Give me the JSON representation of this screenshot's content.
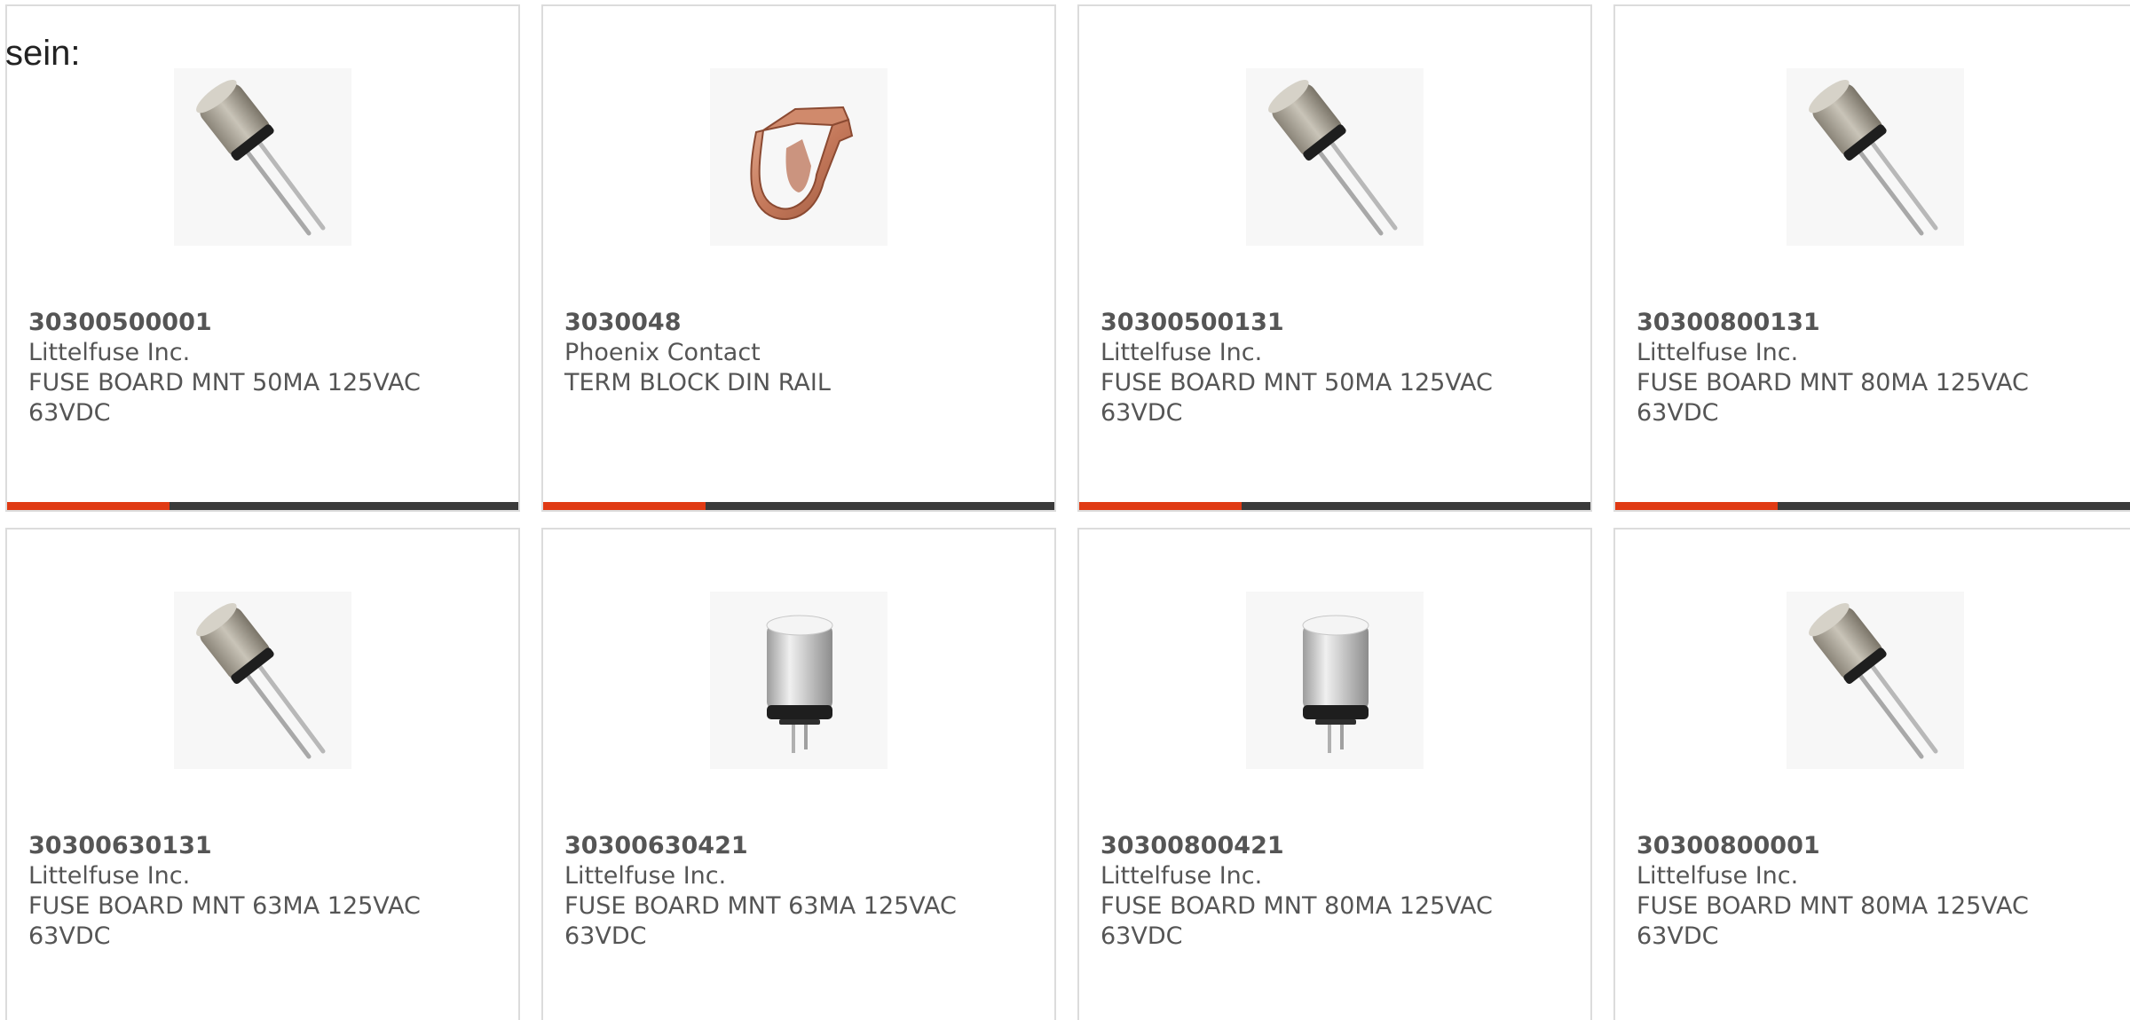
{
  "lead_text": "sein:",
  "colors": {
    "accent": "#e03a14",
    "bar": "#3a3a3a",
    "border": "#dcdcdc",
    "text": "#555555"
  },
  "products": [
    {
      "part_number": "30300500001",
      "manufacturer": "Littelfuse Inc.",
      "description": "FUSE BOARD MNT 50MA 125VAC 63VDC",
      "image": "radial-fuse-angled-icon"
    },
    {
      "part_number": "3030048",
      "manufacturer": "Phoenix Contact",
      "description": "TERM BLOCK DIN RAIL",
      "image": "copper-clip-icon"
    },
    {
      "part_number": "30300500131",
      "manufacturer": "Littelfuse Inc.",
      "description": "FUSE BOARD MNT 50MA 125VAC 63VDC",
      "image": "radial-fuse-angled-icon"
    },
    {
      "part_number": "30300800131",
      "manufacturer": "Littelfuse Inc.",
      "description": "FUSE BOARD MNT 80MA 125VAC 63VDC",
      "image": "radial-fuse-angled-icon"
    },
    {
      "part_number": "30300630131",
      "manufacturer": "Littelfuse Inc.",
      "description": "FUSE BOARD MNT 63MA 125VAC 63VDC",
      "image": "radial-fuse-angled-icon"
    },
    {
      "part_number": "30300630421",
      "manufacturer": "Littelfuse Inc.",
      "description": "FUSE BOARD MNT 63MA 125VAC 63VDC",
      "image": "radial-fuse-upright-icon"
    },
    {
      "part_number": "30300800421",
      "manufacturer": "Littelfuse Inc.",
      "description": "FUSE BOARD MNT 80MA 125VAC 63VDC",
      "image": "radial-fuse-upright-icon"
    },
    {
      "part_number": "30300800001",
      "manufacturer": "Littelfuse Inc.",
      "description": "FUSE BOARD MNT 80MA 125VAC 63VDC",
      "image": "radial-fuse-angled-icon"
    }
  ]
}
